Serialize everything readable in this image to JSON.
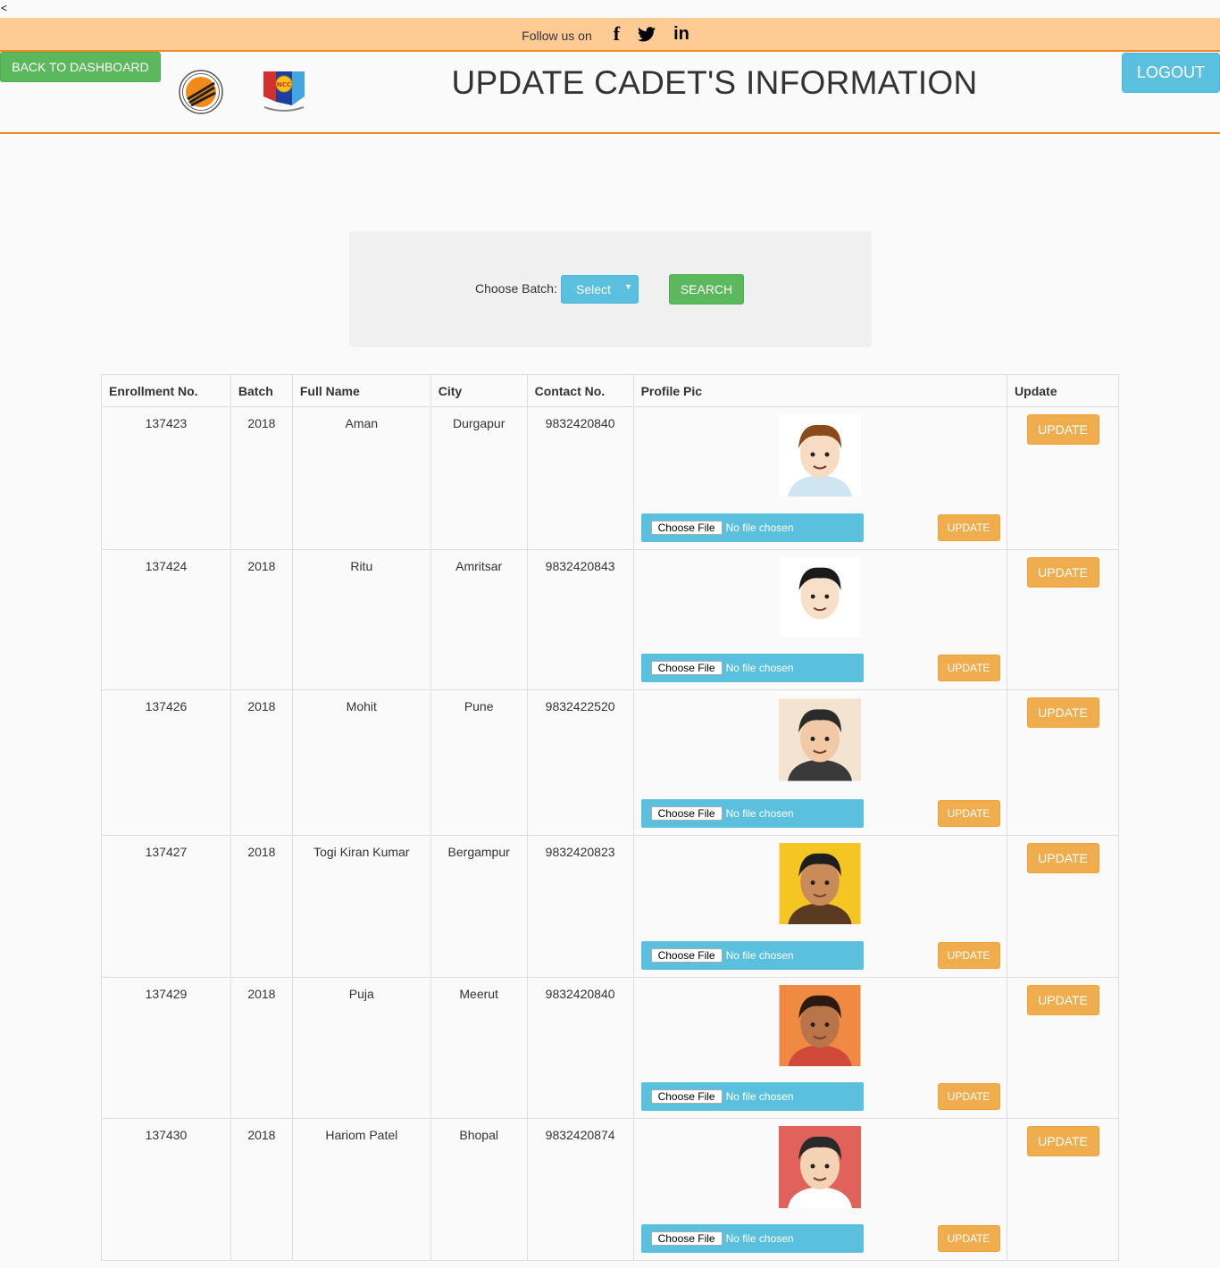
{
  "stray_char": "<",
  "topbar": {
    "follow_text": "Follow us on",
    "social": [
      {
        "name": "facebook-icon",
        "glyph": "f"
      },
      {
        "name": "twitter-icon",
        "glyph": ""
      },
      {
        "name": "linkedin-icon",
        "glyph": "in"
      }
    ]
  },
  "header": {
    "back_label": "BACK TO DASHBOARD",
    "title": "UPDATE CADET'S INFORMATION",
    "logout_label": "LOGOUT"
  },
  "search": {
    "label": "Choose Batch:",
    "select_value": "Select",
    "button_label": "SEARCH"
  },
  "table": {
    "headers": [
      "Enrollment No.",
      "Batch",
      "Full Name",
      "City",
      "Contact No.",
      "Profile Pic",
      "Update"
    ],
    "file_button": "Choose File",
    "file_status": "No file chosen",
    "pic_update_label": "UPDATE",
    "update_label": "UPDATE",
    "rows": [
      {
        "enrollment": "137423",
        "batch": "2018",
        "name": "Aman",
        "city": "Durgapur",
        "contact": "9832420840",
        "avatar": "man-light-hair-avatar",
        "avatar_bg": "#ffffff"
      },
      {
        "enrollment": "137424",
        "batch": "2018",
        "name": "Ritu",
        "city": "Amritsar",
        "contact": "9832420843",
        "avatar": "woman-glasses-avatar",
        "avatar_bg": "#ffffff"
      },
      {
        "enrollment": "137426",
        "batch": "2018",
        "name": "Mohit",
        "city": "Pune",
        "contact": "9832422520",
        "avatar": "man-dark-hair-avatar",
        "avatar_bg": "#f3e4d2"
      },
      {
        "enrollment": "137427",
        "batch": "2018",
        "name": "Togi Kiran Kumar",
        "city": "Bergampur",
        "contact": "9832420823",
        "avatar": "man-glasses-avatar",
        "avatar_bg": "#f5c523"
      },
      {
        "enrollment": "137429",
        "batch": "2018",
        "name": "Puja",
        "city": "Meerut",
        "contact": "9832420840",
        "avatar": "woman-dark-hair-avatar",
        "avatar_bg": "#f08a43"
      },
      {
        "enrollment": "137430",
        "batch": "2018",
        "name": "Hariom Patel",
        "city": "Bhopal",
        "contact": "9832420874",
        "avatar": "man-beard-avatar",
        "avatar_bg": "#e0625a"
      }
    ]
  }
}
